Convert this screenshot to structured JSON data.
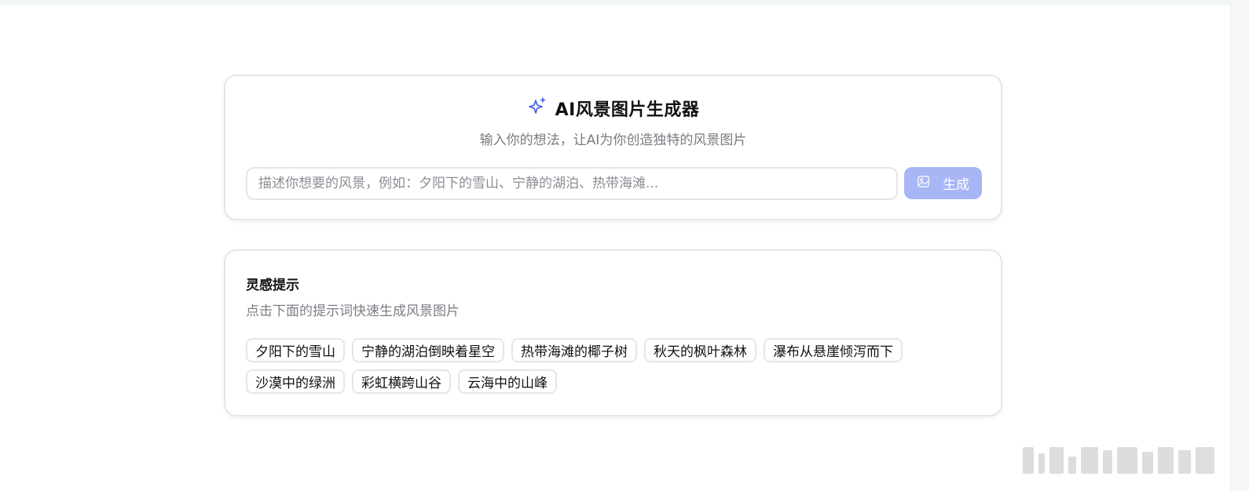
{
  "generator": {
    "title": "AI风景图片生成器",
    "subtitle": "输入你的想法，让AI为你创造独特的风景图片",
    "input_placeholder": "描述你想要的风景，例如：夕阳下的雪山、宁静的湖泊、热带海滩...",
    "input_value": "",
    "button_label": "生成",
    "title_icon": "sparkle-icon",
    "button_icon": "image-icon",
    "accent_color": "#3b5bdb",
    "button_color": "#a8b6f5"
  },
  "inspiration": {
    "title": "灵感提示",
    "subtitle": "点击下面的提示词快速生成风景图片",
    "chips": [
      "夕阳下的雪山",
      "宁静的湖泊倒映着星空",
      "热带海滩的椰子树",
      "秋天的枫叶森林",
      "瀑布从悬崖倾泻而下",
      "沙漠中的绿洲",
      "彩虹横跨山谷",
      "云海中的山峰"
    ]
  }
}
